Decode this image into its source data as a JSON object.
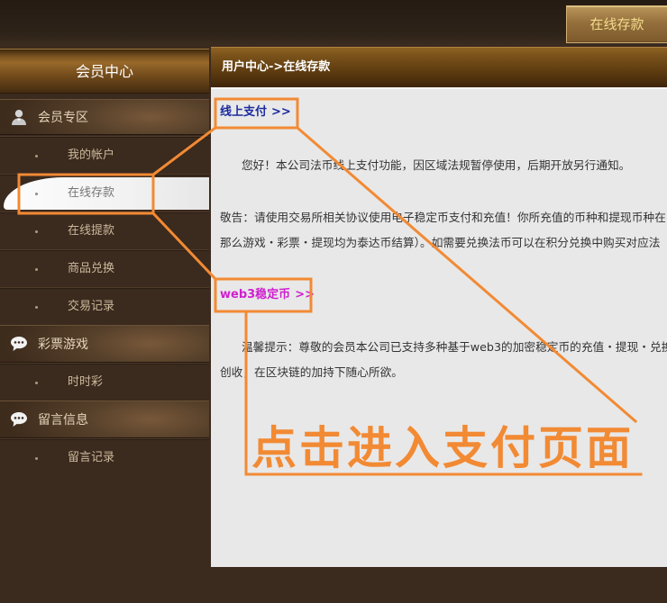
{
  "topbar": {
    "deposit_button": "在线存款"
  },
  "sidebar": {
    "title": "会员中心",
    "sections": [
      {
        "label": "会员专区",
        "icon": "user-icon",
        "items": [
          {
            "label": "我的帐户",
            "active": false
          },
          {
            "label": "在线存款",
            "active": true
          },
          {
            "label": "在线提款",
            "active": false
          },
          {
            "label": "商品兑换",
            "active": false
          },
          {
            "label": "交易记录",
            "active": false
          }
        ]
      },
      {
        "label": "彩票游戏",
        "icon": "chat-bubble-icon",
        "items": [
          {
            "label": "时时彩",
            "active": false
          }
        ]
      },
      {
        "label": "留言信息",
        "icon": "chat-bubble-icon",
        "items": [
          {
            "label": "留言记录",
            "active": false
          }
        ]
      }
    ]
  },
  "main": {
    "breadcrumb": "用户中心->在线存款",
    "online_payment": {
      "link_label": "线上支付",
      "link_arrow": ">>",
      "notice": "您好！本公司法币线上支付功能，因区域法规暂停使用，后期开放另行通知。",
      "warning_lines": [
        "敬告：请使用交易所相关协议使用电子稳定币支付和充值！你所充值的币种和提现币种在",
        "那么游戏・彩票・提现均为泰达币结算）。如需要兑换法币可以在积分兑换中购买对应法"
      ]
    },
    "web3": {
      "link_label": "web3稳定币",
      "link_arrow": ">>",
      "tip_lines": [
        "温馨提示：尊敬的会员本公司已支持多种基于web3的加密稳定币的充值・提现・兑换",
        "创收，在区块链的加持下随心所欲。"
      ]
    }
  },
  "annotation": {
    "callout_text": "点击进入支付页面"
  },
  "colors": {
    "annotation_orange": "#f28a34",
    "payment_link_blue": "#1b2a9e",
    "web3_link_magenta": "#d01fd0",
    "content_bg": "#e8e8e8",
    "sidebar_bg": "#3b2a1e"
  }
}
